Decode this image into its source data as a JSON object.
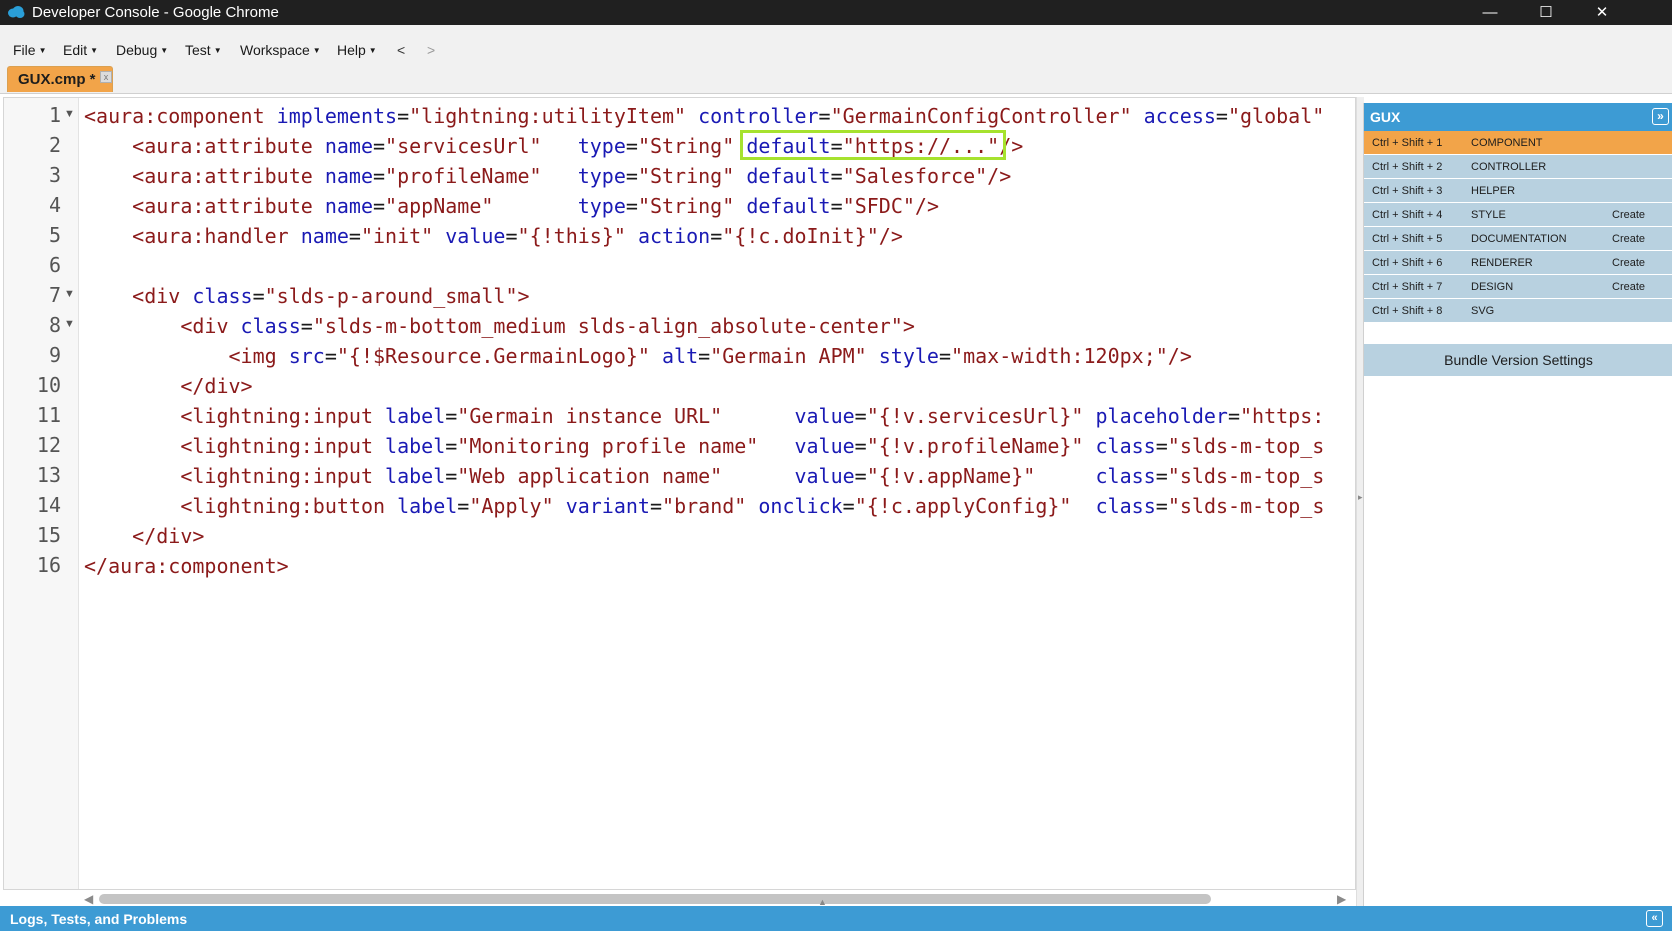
{
  "window": {
    "title": "Developer Console - Google Chrome",
    "minimize_glyph": "—",
    "maximize_glyph": "☐",
    "close_glyph": "✕"
  },
  "menu": [
    {
      "label": "File"
    },
    {
      "label": "Edit"
    },
    {
      "label": "Debug"
    },
    {
      "label": "Test"
    },
    {
      "label": "Workspace"
    },
    {
      "label": "Help"
    },
    {
      "label": "<"
    },
    {
      "label": ">"
    }
  ],
  "tab": {
    "label": "GUX.cmp *",
    "close_glyph": "x"
  },
  "editor": {
    "line_numbers": [
      "1",
      "2",
      "3",
      "4",
      "5",
      "6",
      "7",
      "8",
      "9",
      "10",
      "11",
      "12",
      "13",
      "14",
      "15",
      "16"
    ],
    "fold_glyph": "▼",
    "lines": [
      [
        {
          "k": "t",
          "s": "<aura:component "
        },
        {
          "k": "a",
          "s": "implements"
        },
        {
          "k": "p",
          "s": "="
        },
        {
          "k": "v",
          "s": "\"lightning:utilityItem\""
        },
        {
          "k": "p",
          "s": " "
        },
        {
          "k": "a",
          "s": "controller"
        },
        {
          "k": "p",
          "s": "="
        },
        {
          "k": "v",
          "s": "\"GermainConfigController\""
        },
        {
          "k": "p",
          "s": " "
        },
        {
          "k": "a",
          "s": "access"
        },
        {
          "k": "p",
          "s": "="
        },
        {
          "k": "v",
          "s": "\"global\""
        }
      ],
      [
        {
          "k": "t",
          "s": "    <aura:attribute "
        },
        {
          "k": "a",
          "s": "name"
        },
        {
          "k": "p",
          "s": "="
        },
        {
          "k": "v",
          "s": "\"servicesUrl\""
        },
        {
          "k": "p",
          "s": "   "
        },
        {
          "k": "a",
          "s": "type"
        },
        {
          "k": "p",
          "s": "="
        },
        {
          "k": "v",
          "s": "\"String\""
        },
        {
          "k": "p",
          "s": " "
        },
        {
          "k": "a",
          "s": "default"
        },
        {
          "k": "p",
          "s": "="
        },
        {
          "k": "v",
          "s": "\"https://...\""
        },
        {
          "k": "t",
          "s": "/>"
        }
      ],
      [
        {
          "k": "t",
          "s": "    <aura:attribute "
        },
        {
          "k": "a",
          "s": "name"
        },
        {
          "k": "p",
          "s": "="
        },
        {
          "k": "v",
          "s": "\"profileName\""
        },
        {
          "k": "p",
          "s": "   "
        },
        {
          "k": "a",
          "s": "type"
        },
        {
          "k": "p",
          "s": "="
        },
        {
          "k": "v",
          "s": "\"String\""
        },
        {
          "k": "p",
          "s": " "
        },
        {
          "k": "a",
          "s": "default"
        },
        {
          "k": "p",
          "s": "="
        },
        {
          "k": "v",
          "s": "\"Salesforce\""
        },
        {
          "k": "t",
          "s": "/>"
        }
      ],
      [
        {
          "k": "t",
          "s": "    <aura:attribute "
        },
        {
          "k": "a",
          "s": "name"
        },
        {
          "k": "p",
          "s": "="
        },
        {
          "k": "v",
          "s": "\"appName\""
        },
        {
          "k": "p",
          "s": "       "
        },
        {
          "k": "a",
          "s": "type"
        },
        {
          "k": "p",
          "s": "="
        },
        {
          "k": "v",
          "s": "\"String\""
        },
        {
          "k": "p",
          "s": " "
        },
        {
          "k": "a",
          "s": "default"
        },
        {
          "k": "p",
          "s": "="
        },
        {
          "k": "v",
          "s": "\"SFDC\""
        },
        {
          "k": "t",
          "s": "/>"
        }
      ],
      [
        {
          "k": "t",
          "s": "    <aura:handler "
        },
        {
          "k": "a",
          "s": "name"
        },
        {
          "k": "p",
          "s": "="
        },
        {
          "k": "v",
          "s": "\"init\""
        },
        {
          "k": "p",
          "s": " "
        },
        {
          "k": "a",
          "s": "value"
        },
        {
          "k": "p",
          "s": "="
        },
        {
          "k": "v",
          "s": "\"{!this}\""
        },
        {
          "k": "p",
          "s": " "
        },
        {
          "k": "a",
          "s": "action"
        },
        {
          "k": "p",
          "s": "="
        },
        {
          "k": "v",
          "s": "\"{!c.doInit}\""
        },
        {
          "k": "t",
          "s": "/>"
        }
      ],
      [],
      [
        {
          "k": "t",
          "s": "    <div "
        },
        {
          "k": "a",
          "s": "class"
        },
        {
          "k": "p",
          "s": "="
        },
        {
          "k": "v",
          "s": "\"slds-p-around_small\""
        },
        {
          "k": "t",
          "s": ">"
        }
      ],
      [
        {
          "k": "t",
          "s": "        <div "
        },
        {
          "k": "a",
          "s": "class"
        },
        {
          "k": "p",
          "s": "="
        },
        {
          "k": "v",
          "s": "\"slds-m-bottom_medium slds-align_absolute-center\""
        },
        {
          "k": "t",
          "s": ">"
        }
      ],
      [
        {
          "k": "t",
          "s": "            <img "
        },
        {
          "k": "a",
          "s": "src"
        },
        {
          "k": "p",
          "s": "="
        },
        {
          "k": "v",
          "s": "\"{!$Resource.GermainLogo}\""
        },
        {
          "k": "p",
          "s": " "
        },
        {
          "k": "a",
          "s": "alt"
        },
        {
          "k": "p",
          "s": "="
        },
        {
          "k": "v",
          "s": "\"Germain APM\""
        },
        {
          "k": "p",
          "s": " "
        },
        {
          "k": "a",
          "s": "style"
        },
        {
          "k": "p",
          "s": "="
        },
        {
          "k": "v",
          "s": "\"max-width:120px;\""
        },
        {
          "k": "t",
          "s": "/>"
        }
      ],
      [
        {
          "k": "t",
          "s": "        </div>"
        }
      ],
      [
        {
          "k": "t",
          "s": "        <lightning:input "
        },
        {
          "k": "a",
          "s": "label"
        },
        {
          "k": "p",
          "s": "="
        },
        {
          "k": "v",
          "s": "\"Germain instance URL\""
        },
        {
          "k": "p",
          "s": "      "
        },
        {
          "k": "a",
          "s": "value"
        },
        {
          "k": "p",
          "s": "="
        },
        {
          "k": "v",
          "s": "\"{!v.servicesUrl}\""
        },
        {
          "k": "p",
          "s": " "
        },
        {
          "k": "a",
          "s": "placeholder"
        },
        {
          "k": "p",
          "s": "="
        },
        {
          "k": "v",
          "s": "\"https:"
        }
      ],
      [
        {
          "k": "t",
          "s": "        <lightning:input "
        },
        {
          "k": "a",
          "s": "label"
        },
        {
          "k": "p",
          "s": "="
        },
        {
          "k": "v",
          "s": "\"Monitoring profile name\""
        },
        {
          "k": "p",
          "s": "   "
        },
        {
          "k": "a",
          "s": "value"
        },
        {
          "k": "p",
          "s": "="
        },
        {
          "k": "v",
          "s": "\"{!v.profileName}\""
        },
        {
          "k": "p",
          "s": " "
        },
        {
          "k": "a",
          "s": "class"
        },
        {
          "k": "p",
          "s": "="
        },
        {
          "k": "v",
          "s": "\"slds-m-top_s"
        }
      ],
      [
        {
          "k": "t",
          "s": "        <lightning:input "
        },
        {
          "k": "a",
          "s": "label"
        },
        {
          "k": "p",
          "s": "="
        },
        {
          "k": "v",
          "s": "\"Web application name\""
        },
        {
          "k": "p",
          "s": "      "
        },
        {
          "k": "a",
          "s": "value"
        },
        {
          "k": "p",
          "s": "="
        },
        {
          "k": "v",
          "s": "\"{!v.appName}\""
        },
        {
          "k": "p",
          "s": "     "
        },
        {
          "k": "a",
          "s": "class"
        },
        {
          "k": "p",
          "s": "="
        },
        {
          "k": "v",
          "s": "\"slds-m-top_s"
        }
      ],
      [
        {
          "k": "t",
          "s": "        <lightning:button "
        },
        {
          "k": "a",
          "s": "label"
        },
        {
          "k": "p",
          "s": "="
        },
        {
          "k": "v",
          "s": "\"Apply\""
        },
        {
          "k": "p",
          "s": " "
        },
        {
          "k": "a",
          "s": "variant"
        },
        {
          "k": "p",
          "s": "="
        },
        {
          "k": "v",
          "s": "\"brand\""
        },
        {
          "k": "p",
          "s": " "
        },
        {
          "k": "a",
          "s": "onclick"
        },
        {
          "k": "p",
          "s": "="
        },
        {
          "k": "v",
          "s": "\"{!c.applyConfig}\""
        },
        {
          "k": "p",
          "s": "  "
        },
        {
          "k": "a",
          "s": "class"
        },
        {
          "k": "p",
          "s": "="
        },
        {
          "k": "v",
          "s": "\"slds-m-top_s"
        }
      ],
      [
        {
          "k": "t",
          "s": "    </div>"
        }
      ],
      [
        {
          "k": "t",
          "s": "</aura:component>"
        }
      ]
    ],
    "highlighted_text": "default=\"https://...\""
  },
  "gux": {
    "title": "GUX",
    "collapse_glyph": "»",
    "rows": [
      {
        "shortcut": "Ctrl + Shift + 1",
        "name": "COMPONENT",
        "action": "",
        "active": true
      },
      {
        "shortcut": "Ctrl + Shift + 2",
        "name": "CONTROLLER",
        "action": "",
        "active": false
      },
      {
        "shortcut": "Ctrl + Shift + 3",
        "name": "HELPER",
        "action": "",
        "active": false
      },
      {
        "shortcut": "Ctrl + Shift + 4",
        "name": "STYLE",
        "action": "Create",
        "active": false
      },
      {
        "shortcut": "Ctrl + Shift + 5",
        "name": "DOCUMENTATION",
        "action": "Create",
        "active": false
      },
      {
        "shortcut": "Ctrl + Shift + 6",
        "name": "RENDERER",
        "action": "Create",
        "active": false
      },
      {
        "shortcut": "Ctrl + Shift + 7",
        "name": "DESIGN",
        "action": "Create",
        "active": false
      },
      {
        "shortcut": "Ctrl + Shift + 8",
        "name": "SVG",
        "action": "",
        "active": false
      }
    ],
    "bundle_label": "Bundle Version Settings"
  },
  "logs": {
    "title": "Logs, Tests, and Problems",
    "expand_glyph": "«"
  },
  "colors": {
    "accent": "#3d9bd4",
    "tab": "#f2a449",
    "active_row": "#f2a449",
    "row": "#b8d1e0",
    "highlight": "#a6e22e",
    "tag": "#8b1a1a",
    "attribute": "#1a1ab4"
  }
}
